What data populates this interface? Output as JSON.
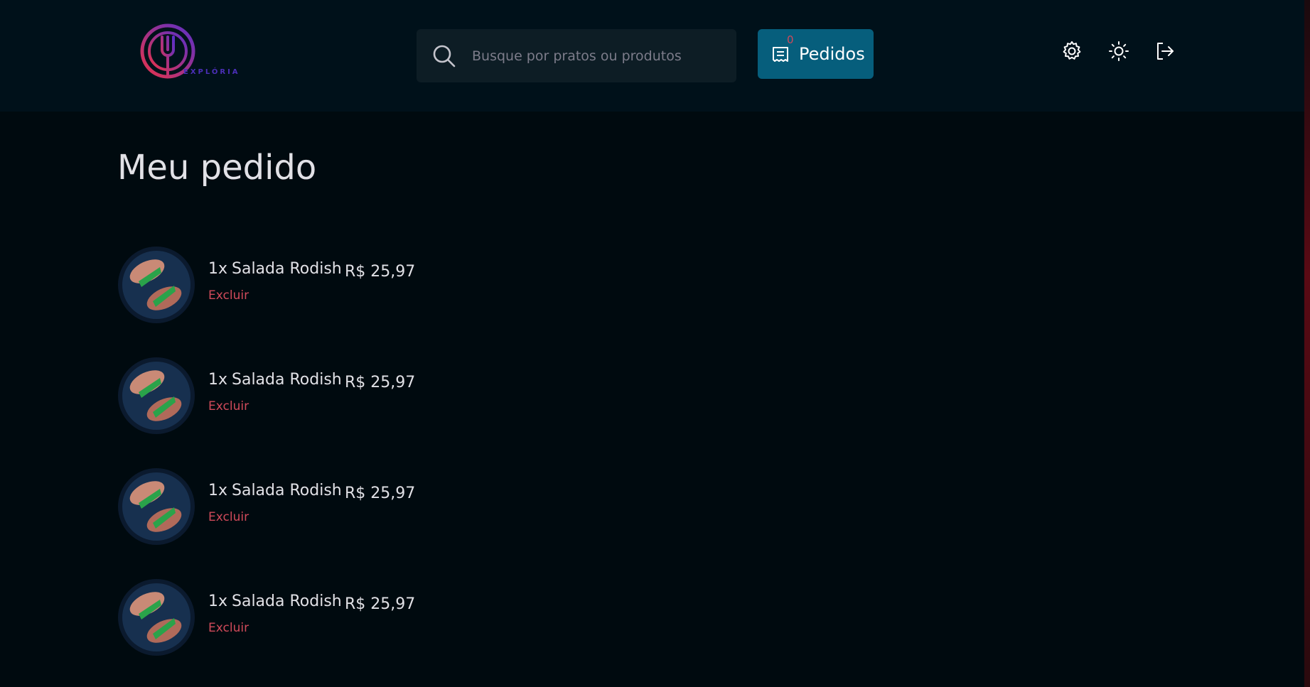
{
  "header": {
    "logo_text": "EXPLÓRIA",
    "search": {
      "placeholder": "Busque por pratos ou produtos",
      "value": ""
    },
    "orders_button": {
      "label": "Pedidos",
      "count": "0"
    },
    "icons": [
      "gear-icon",
      "sun-icon",
      "sign-out-icon"
    ]
  },
  "page": {
    "title": "Meu pedido"
  },
  "order_items": [
    {
      "qty": "1x",
      "name": "Salada Rodish",
      "price": "R$ 25,97",
      "remove_label": "Excluir"
    },
    {
      "qty": "1x",
      "name": "Salada Rodish",
      "price": "R$ 25,97",
      "remove_label": "Excluir"
    },
    {
      "qty": "1x",
      "name": "Salada Rodish",
      "price": "R$ 25,97",
      "remove_label": "Excluir"
    },
    {
      "qty": "1x",
      "name": "Salada Rodish",
      "price": "R$ 25,97",
      "remove_label": "Excluir"
    }
  ],
  "colors": {
    "background": "#000a0f",
    "header": "#00111a",
    "search_bg": "#0d1d25",
    "accent_button": "#065e7c",
    "danger_text": "#d04a5a"
  }
}
